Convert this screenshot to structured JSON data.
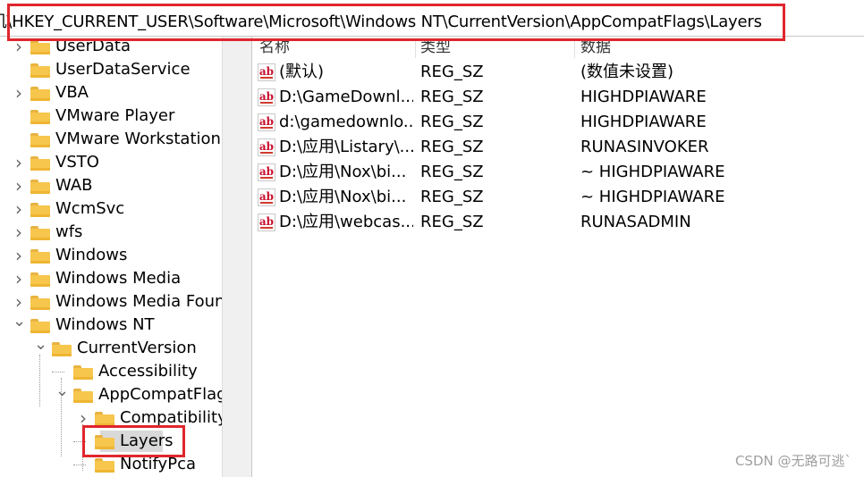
{
  "address": {
    "path": "计算机\\HKEY_CURRENT_USER\\Software\\Microsoft\\Windows NT\\CurrentVersion\\AppCompatFlags\\Layers"
  },
  "tree": {
    "items": [
      {
        "label": "UserData",
        "expander": "chevron-right"
      },
      {
        "label": "UserDataService",
        "expander": ""
      },
      {
        "label": "VBA",
        "expander": "chevron-right"
      },
      {
        "label": "VMware Player",
        "expander": ""
      },
      {
        "label": "VMware Workstation",
        "expander": ""
      },
      {
        "label": "VSTO",
        "expander": "chevron-right"
      },
      {
        "label": "WAB",
        "expander": "chevron-right"
      },
      {
        "label": "WcmSvc",
        "expander": "chevron-right"
      },
      {
        "label": "wfs",
        "expander": "chevron-right"
      },
      {
        "label": "Windows",
        "expander": "chevron-right"
      },
      {
        "label": "Windows Media",
        "expander": "chevron-right"
      },
      {
        "label": "Windows Media Foun",
        "expander": "chevron-right"
      },
      {
        "label": "Windows NT",
        "expander": "chevron-down"
      },
      {
        "label": "CurrentVersion",
        "expander": "chevron-down"
      },
      {
        "label": "Accessibility",
        "expander": ""
      },
      {
        "label": "AppCompatFlag",
        "expander": "chevron-down"
      },
      {
        "label": "Compatibility",
        "expander": "chevron-right"
      },
      {
        "label": "Layers",
        "expander": "",
        "selected": true
      },
      {
        "label": "NotifyPca",
        "expander": ""
      }
    ]
  },
  "values": {
    "headers": {
      "name": "名称",
      "type": "类型",
      "data": "数据"
    },
    "rows": [
      {
        "name": "(默认)",
        "type": "REG_SZ",
        "data": "(数值未设置)"
      },
      {
        "name": "D:\\GameDownl...",
        "type": "REG_SZ",
        "data": "HIGHDPIAWARE"
      },
      {
        "name": "d:\\gamedownlo...",
        "type": "REG_SZ",
        "data": "HIGHDPIAWARE"
      },
      {
        "name": "D:\\应用\\Listary\\...",
        "type": "REG_SZ",
        "data": "RUNASINVOKER"
      },
      {
        "name": "D:\\应用\\Nox\\bi...",
        "type": "REG_SZ",
        "data": "~ HIGHDPIAWARE"
      },
      {
        "name": "D:\\应用\\Nox\\bi...",
        "type": "REG_SZ",
        "data": "~ HIGHDPIAWARE"
      },
      {
        "name": "D:\\应用\\webcas...",
        "type": "REG_SZ",
        "data": "RUNASADMIN"
      }
    ],
    "value_icon": "ab-string-icon"
  },
  "watermark": "CSDN @无路可逃`",
  "colors": {
    "highlight_box": "#e0262d",
    "folder": "#f6c64d",
    "selected_bg": "#d9d9d9"
  }
}
